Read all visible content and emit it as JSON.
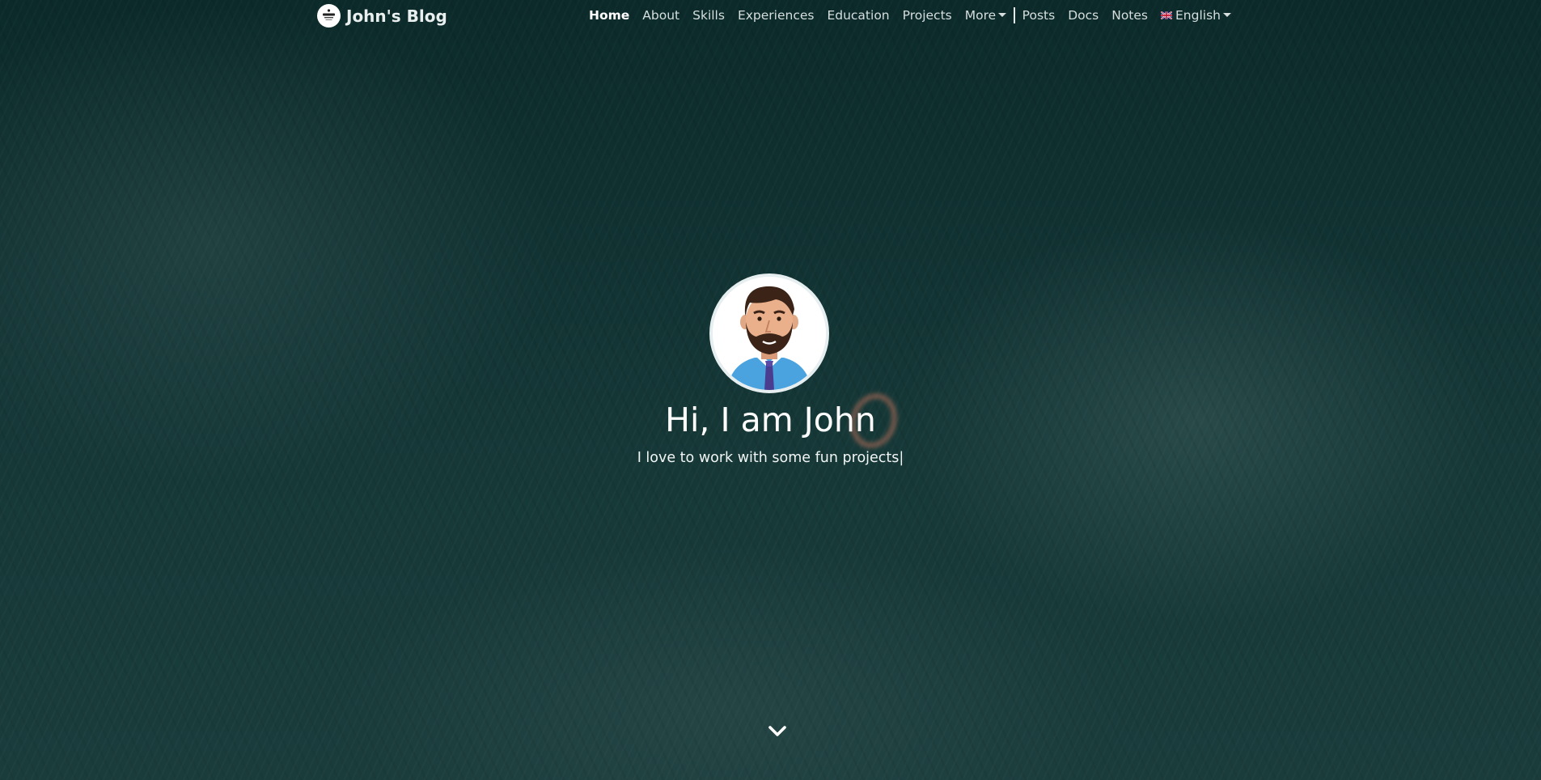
{
  "brand": {
    "title": "John's Blog",
    "logo_icon": "blog-logo-icon"
  },
  "nav": {
    "items": [
      {
        "label": "Home",
        "active": true
      },
      {
        "label": "About"
      },
      {
        "label": "Skills"
      },
      {
        "label": "Experiences"
      },
      {
        "label": "Education"
      },
      {
        "label": "Projects"
      }
    ],
    "more_label": "More",
    "secondary_items": [
      {
        "label": "Posts"
      },
      {
        "label": "Docs"
      },
      {
        "label": "Notes"
      }
    ],
    "language": {
      "label": "English",
      "flag_icon": "uk-flag-icon"
    }
  },
  "hero": {
    "greeting": "Hi, I am John",
    "tagline": "I love to work with some fun projects",
    "cursor": "|",
    "avatar_icon": "bearded-man-avatar-icon",
    "scroll_icon": "chevron-down-icon"
  },
  "colors": {
    "background": "#123333",
    "text": "#ffffff",
    "nav_text": "#d6dede"
  }
}
